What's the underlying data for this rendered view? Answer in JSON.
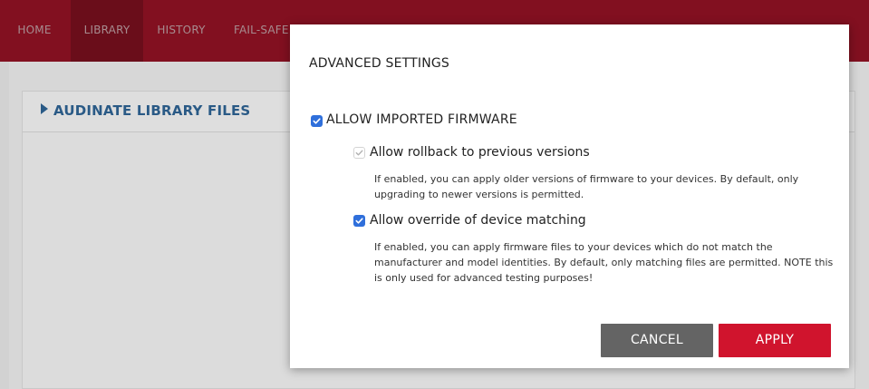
{
  "nav": {
    "items": [
      {
        "label": "HOME"
      },
      {
        "label": "LIBRARY"
      },
      {
        "label": "HISTORY"
      },
      {
        "label": "FAIL-SAFE"
      }
    ],
    "active": "LIBRARY"
  },
  "panel": {
    "title": "AUDINATE LIBRARY FILES"
  },
  "modal": {
    "title": "ADVANCED SETTINGS",
    "allow_imported": {
      "label": "ALLOW IMPORTED FIRMWARE",
      "checked": true
    },
    "rollback": {
      "label": "Allow rollback to previous versions",
      "checked": true,
      "disabled": true,
      "description": "If enabled, you can apply older versions of firmware to your devices. By default, only upgrading to newer versions is permitted."
    },
    "override": {
      "label": "Allow override of device matching",
      "checked": true,
      "description": "If enabled, you can apply firmware files to your devices which do not match the manufacturer and model identities. By default, only matching files are permitted. NOTE this is only used for advanced testing purposes!"
    },
    "buttons": {
      "cancel": "CANCEL",
      "apply": "APPLY"
    }
  },
  "colors": {
    "nav_bg": "#b5172d",
    "accent_blue": "#2f6fdb",
    "title_blue": "#2a5a86",
    "apply_red": "#d0142d",
    "cancel_gray": "#646464"
  }
}
